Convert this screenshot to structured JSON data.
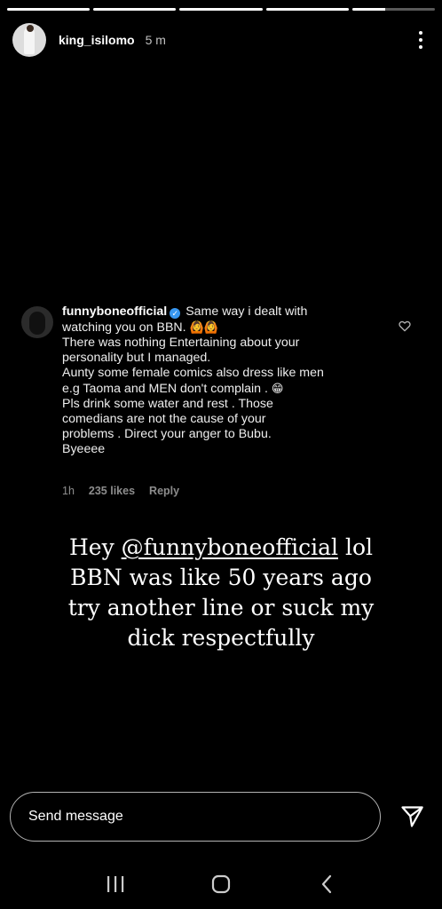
{
  "story": {
    "progress": [
      1,
      1,
      1,
      1,
      0.4
    ],
    "username": "king_isilomo",
    "time": "5 m"
  },
  "comment": {
    "username": "funnyboneofficial",
    "lines": [
      "Same way i dealt with",
      "watching you on BBN.",
      "There was nothing Entertaining about your",
      "personality but I managed.",
      "Aunty some female comics also dress like men",
      "e.g Taoma and MEN don't complain .",
      "Pls drink some water and rest . Those",
      "comedians are not the cause of your",
      "problems . Direct your anger to Bubu.",
      "Byeeee"
    ],
    "emoji_1": "🙆🙆",
    "emoji_2": "😁",
    "age": "1h",
    "likes": "235 likes",
    "reply": "Reply"
  },
  "caption": {
    "prefix": "Hey ",
    "mention": "@funnyboneofficial",
    "line1_suffix": " lol",
    "line2": "BBN was like 50 years ago",
    "line3": "try another line or suck my",
    "line4": "dick respectfully"
  },
  "send": {
    "placeholder": "Send message"
  },
  "icons": {
    "more": "more-vertical-icon",
    "heart": "heart-outline-icon",
    "send": "paper-plane-icon",
    "recents": "recents-icon",
    "home": "home-icon",
    "back": "back-icon"
  }
}
